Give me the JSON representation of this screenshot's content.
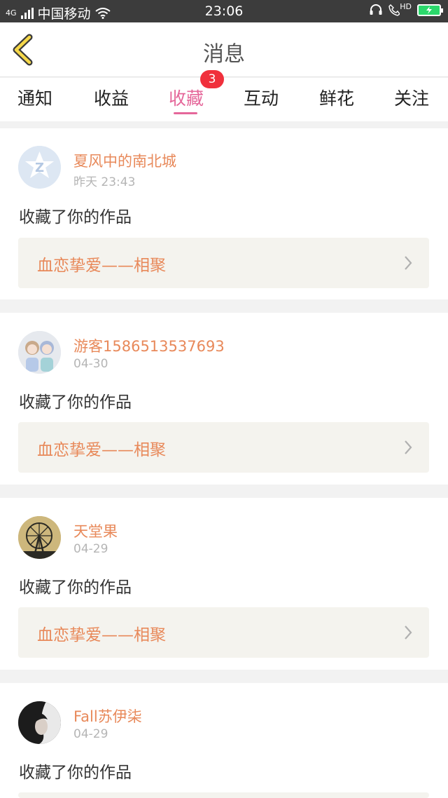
{
  "status_bar": {
    "network": "4G",
    "carrier": "中国移动",
    "time": "23:06",
    "hd_label": "HD",
    "icons": [
      "signal-icon",
      "wifi-icon",
      "headset-icon",
      "hd-call-icon",
      "battery-charging-icon"
    ],
    "battery_color": "#2bd86b"
  },
  "header": {
    "title": "消息",
    "back_icon": "chevron-left-icon"
  },
  "tabs": {
    "items": [
      {
        "label": "通知"
      },
      {
        "label": "收益"
      },
      {
        "label": "收藏",
        "badge": "3",
        "active": true
      },
      {
        "label": "互动"
      },
      {
        "label": "鲜花"
      },
      {
        "label": "关注"
      }
    ]
  },
  "accent_color": "#e5679a",
  "name_color": "#e8895a",
  "messages": [
    {
      "user": "夏风中的南北城",
      "time": "昨天 23:43",
      "action": "收藏了你的作品",
      "work": "血恋挚爱——相聚"
    },
    {
      "user": "游客1586513537693",
      "time": "04-30",
      "action": "收藏了你的作品",
      "work": "血恋挚爱——相聚"
    },
    {
      "user": "天堂果",
      "time": "04-29",
      "action": "收藏了你的作品",
      "work": "血恋挚爱——相聚"
    },
    {
      "user": "Fall苏伊柒",
      "time": "04-29",
      "action": "收藏了你的作品",
      "work": ""
    }
  ]
}
